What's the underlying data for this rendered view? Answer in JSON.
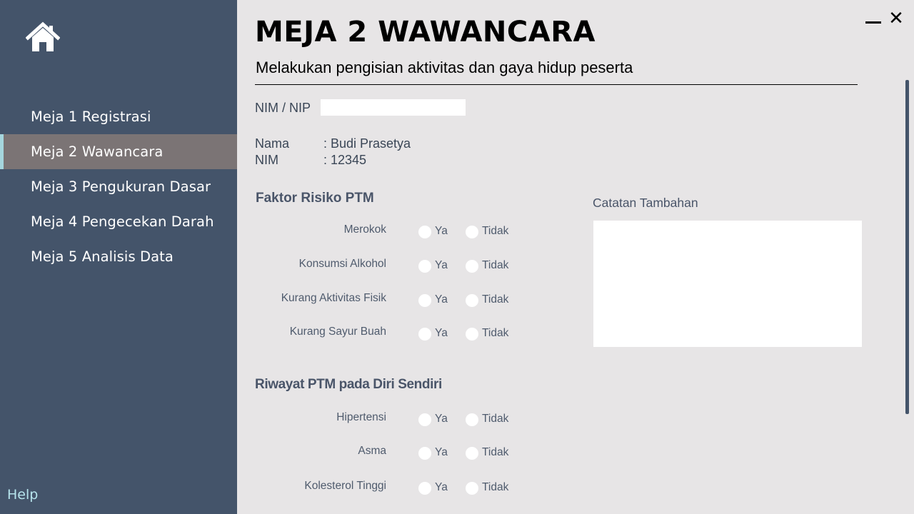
{
  "window": {
    "minimize_icon": "minimize-icon",
    "close_label": "✕"
  },
  "sidebar": {
    "home_icon": "home-icon",
    "items": [
      {
        "label": "Meja 1 Registrasi",
        "active": false
      },
      {
        "label": "Meja 2 Wawancara",
        "active": true
      },
      {
        "label": "Meja 3 Pengukuran Dasar",
        "active": false
      },
      {
        "label": "Meja 4 Pengecekan Darah",
        "active": false
      },
      {
        "label": "Meja 5 Analisis Data",
        "active": false
      }
    ],
    "help_label": "Help"
  },
  "header": {
    "title": "MEJA 2 WAWANCARA",
    "subtitle": "Melakukan pengisian aktivitas dan gaya hidup peserta"
  },
  "form": {
    "nim_label": "NIM / NIP",
    "nim_value": "",
    "nama_label": "Nama",
    "nama_value": ": Budi Prasetya",
    "nim2_label": "NIM",
    "nim2_value": ": 12345",
    "option_yes": "Ya",
    "option_no": "Tidak"
  },
  "faktor": {
    "title": "Faktor Risiko  PTM",
    "questions": [
      "Merokok",
      "Konsumsi  Alkohol",
      "Kurang Aktivitas Fisik",
      "Kurang  Sayur Buah"
    ]
  },
  "riwayat": {
    "title": "Riwayat PTM pada Diri Sendiri",
    "questions": [
      "Hipertensi",
      "Asma",
      "Kolesterol Tinggi"
    ]
  },
  "notes": {
    "label": "Catatan Tambahan",
    "value": ""
  },
  "colors": {
    "sidebar_bg": "#44546a",
    "active_item_bg": "#7b7475",
    "active_indicator": "#a5d6dd",
    "main_bg": "#e7e5e6",
    "help_text": "#b6e4ec"
  }
}
